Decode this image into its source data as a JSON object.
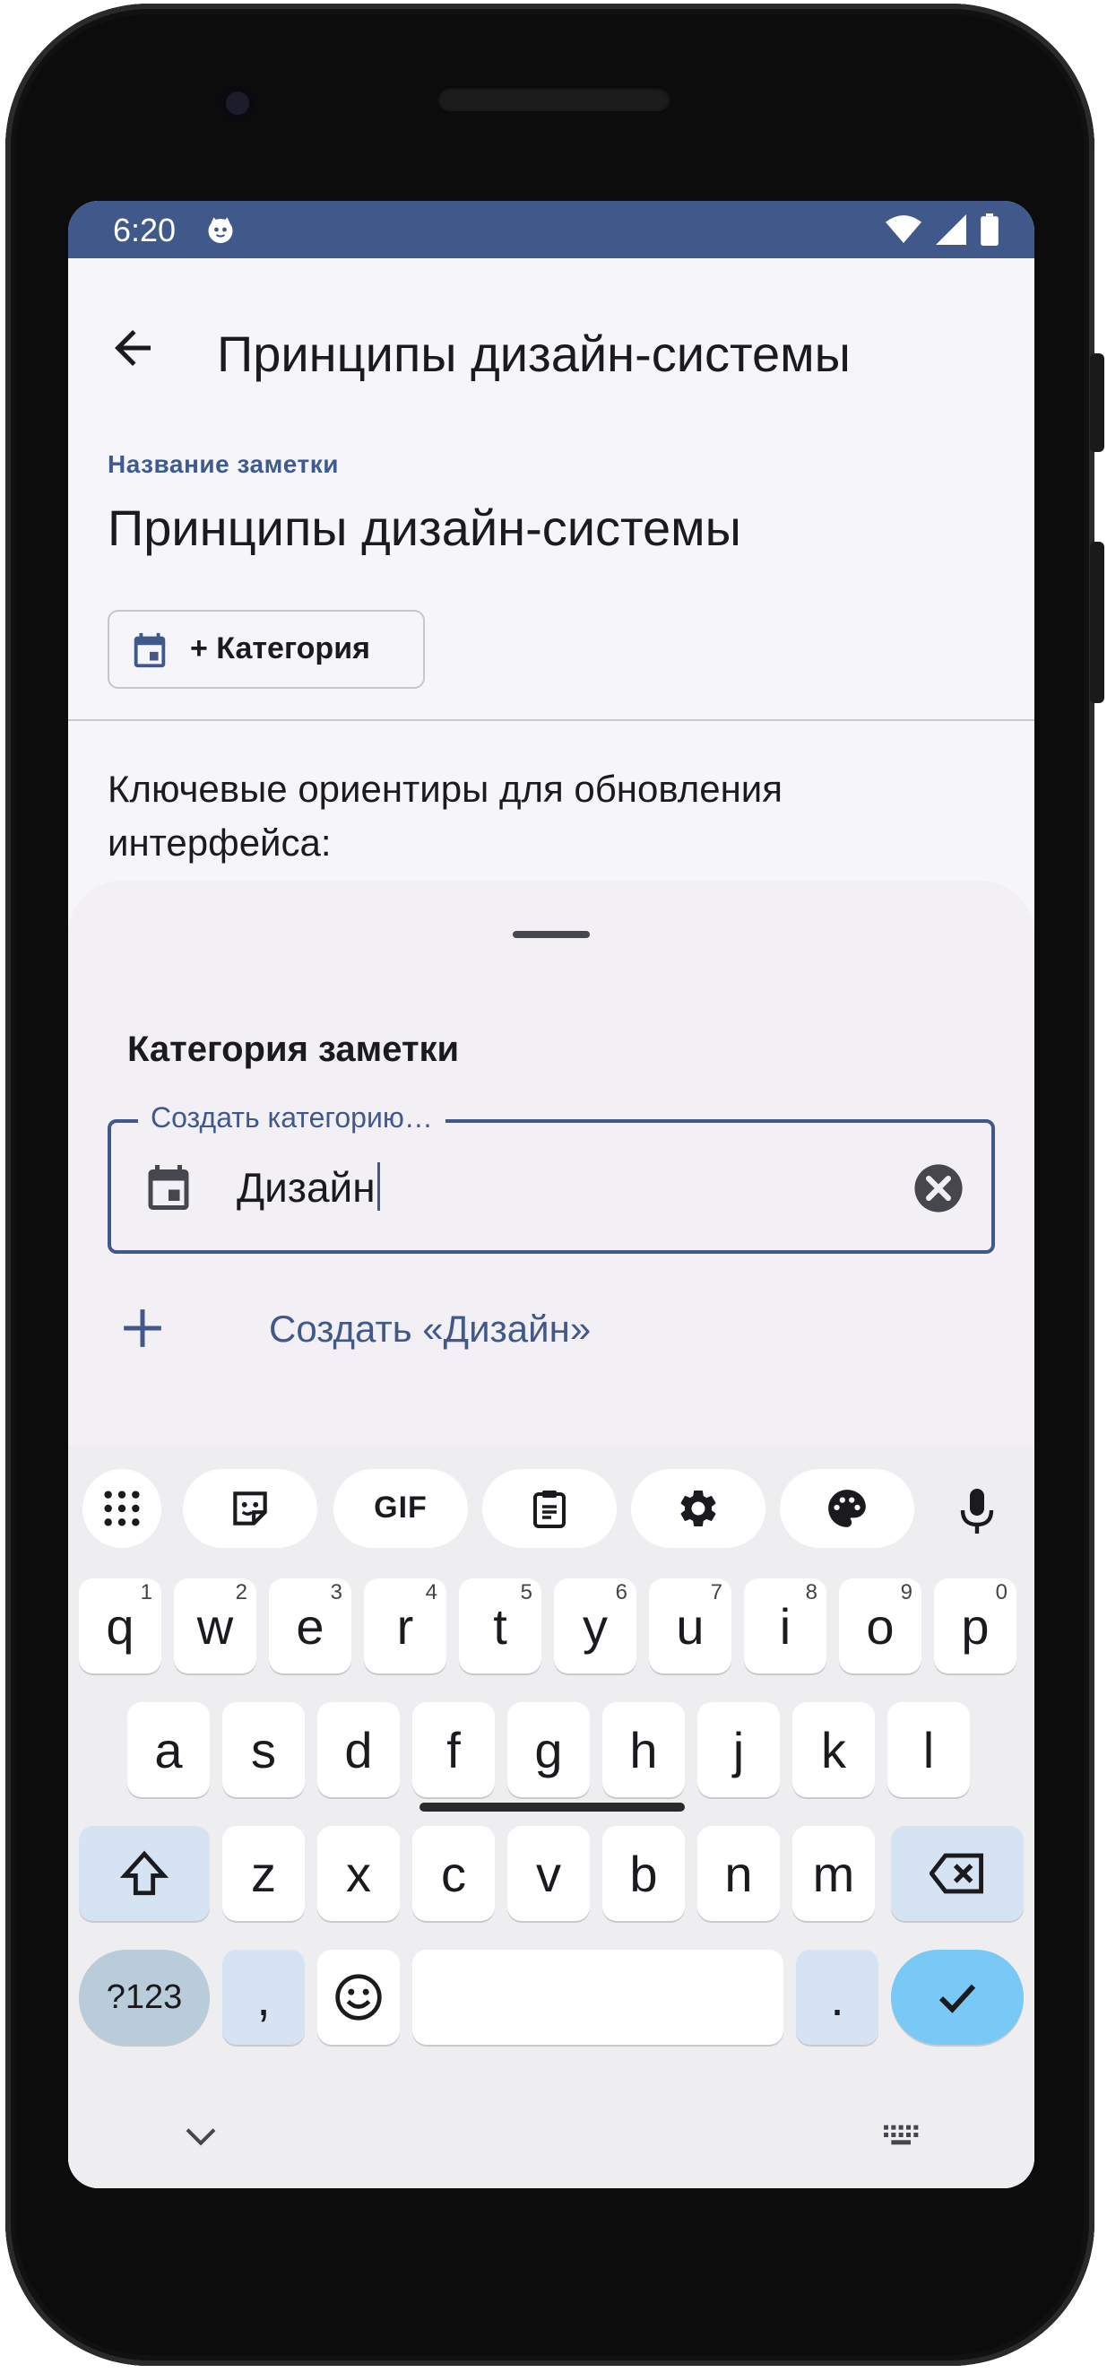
{
  "status_bar": {
    "time": "6:20",
    "background_color": "#41598a",
    "icons": [
      "face-icon",
      "wifi-icon",
      "signal-icon",
      "battery-icon"
    ]
  },
  "app_bar": {
    "back_icon": "arrow-back-icon",
    "title": "Принципы дизайн-системы"
  },
  "note": {
    "field_label": "Название заметки",
    "title": "Принципы дизайн-системы",
    "category_chip": {
      "icon": "calendar-icon",
      "label": "+ Категория"
    },
    "body": "Ключевые ориентиры для обновления интерфейса:"
  },
  "bottom_sheet": {
    "title": "Категория заметки",
    "input": {
      "label": "Создать категорию…",
      "value": "Дизайн",
      "leading_icon": "calendar-icon",
      "trailing_icon": "clear-icon"
    },
    "create_action": {
      "icon": "plus-icon",
      "label": "Создать «Дизайн»"
    }
  },
  "keyboard": {
    "toolbar": [
      "apps-grid-icon",
      "sticker-icon",
      "gif-icon",
      "clipboard-icon",
      "settings-icon",
      "palette-icon",
      "microphone-icon"
    ],
    "row1": [
      {
        "key": "q",
        "hint": "1"
      },
      {
        "key": "w",
        "hint": "2"
      },
      {
        "key": "e",
        "hint": "3"
      },
      {
        "key": "r",
        "hint": "4"
      },
      {
        "key": "t",
        "hint": "5"
      },
      {
        "key": "y",
        "hint": "6"
      },
      {
        "key": "u",
        "hint": "7"
      },
      {
        "key": "i",
        "hint": "8"
      },
      {
        "key": "o",
        "hint": "9"
      },
      {
        "key": "p",
        "hint": "0"
      }
    ],
    "row2": [
      "a",
      "s",
      "d",
      "f",
      "g",
      "h",
      "j",
      "k",
      "l"
    ],
    "row3": [
      "z",
      "x",
      "c",
      "v",
      "b",
      "n",
      "m"
    ],
    "row4": {
      "symbols": "?123",
      "comma": ",",
      "emoji": "emoji-icon",
      "period": ".",
      "enter": "check-icon"
    },
    "gif_label": "GIF",
    "accent_color": "#78c9f6",
    "modifier_color": "#d5e3f3"
  },
  "accent_color": "#41598a"
}
